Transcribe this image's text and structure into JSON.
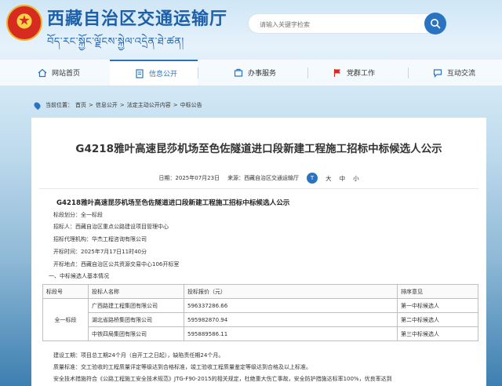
{
  "header": {
    "site_name": "西藏自治区交通运输厅",
    "site_tibetan": "བོད་རང་སྐྱོང་ལྗོངས་སྐྱེལ་འདྲེན་ཐེ་ཚན།",
    "search_placeholder": "请输入关键字检索"
  },
  "nav": {
    "items": [
      {
        "label": "网站首页",
        "icon": "home-icon"
      },
      {
        "label": "信息公开",
        "icon": "document-icon",
        "active": true
      },
      {
        "label": "办事服务",
        "icon": "service-icon"
      },
      {
        "label": "党群工作",
        "icon": "flag-icon"
      },
      {
        "label": "互动交流",
        "icon": "chat-icon"
      }
    ]
  },
  "breadcrumb": {
    "prefix": "当前位置：",
    "items": [
      "首页",
      "信息公开",
      "法定主动公开内容",
      "中标公告"
    ],
    "separator": ">"
  },
  "article": {
    "title": "G4218雅叶高速昆莎机场至色佐隧道进口段新建工程施工招标中标候选人公示",
    "date_label": "日期：",
    "date": "2025年07月23日",
    "source_label": "来源：",
    "source": "西藏自治区交通运输厅",
    "font_size_label": "T",
    "font_large": "大",
    "font_medium": "中",
    "font_small": "小",
    "doc_heading": "G4218雅叶高速昆莎机场至色佐隧道进口段新建工程施工招标中标候选人公示",
    "lines": [
      "标段划分：全一标段",
      "招标人：西藏自治区重点公路建设项目管理中心",
      "招标代理机构：华杰工程咨询有限公司",
      "开标时间：2025年7月17日11时40分",
      "开标地点：西藏自治区公共资源交易中心106开标室",
      "一、中标候选人基本情况"
    ],
    "table": {
      "headers": [
        "标段号",
        "投标人名称",
        "投标报价（元）",
        "排序意见"
      ],
      "section": "全一标段",
      "rows": [
        {
          "name": "广西路建工程集团有限公司",
          "price": "596337286.66",
          "rank": "第一中标候选人"
        },
        {
          "name": "湖北省路桥集团有限公司",
          "price": "595982870.94",
          "rank": "第二中标候选人"
        },
        {
          "name": "中铁四局集团有限公司",
          "price": "595889586.11",
          "rank": "第三中标候选人"
        }
      ]
    },
    "tail_lines": [
      "建设工期：项目总工期24个月（自开工之日起），缺陷责任期24个月。",
      "质量标准：交工验收的工程质量评定等级达到合格标准，竣工验收工程质量鉴定等级达到合格及以上标准。",
      "安全技术措施符合《公路工程施工安全技术规范》JTG-F90-2015的相关规定，杜绝重大伤亡事故，安全防护措施达标率100%，优良率达到"
    ]
  }
}
